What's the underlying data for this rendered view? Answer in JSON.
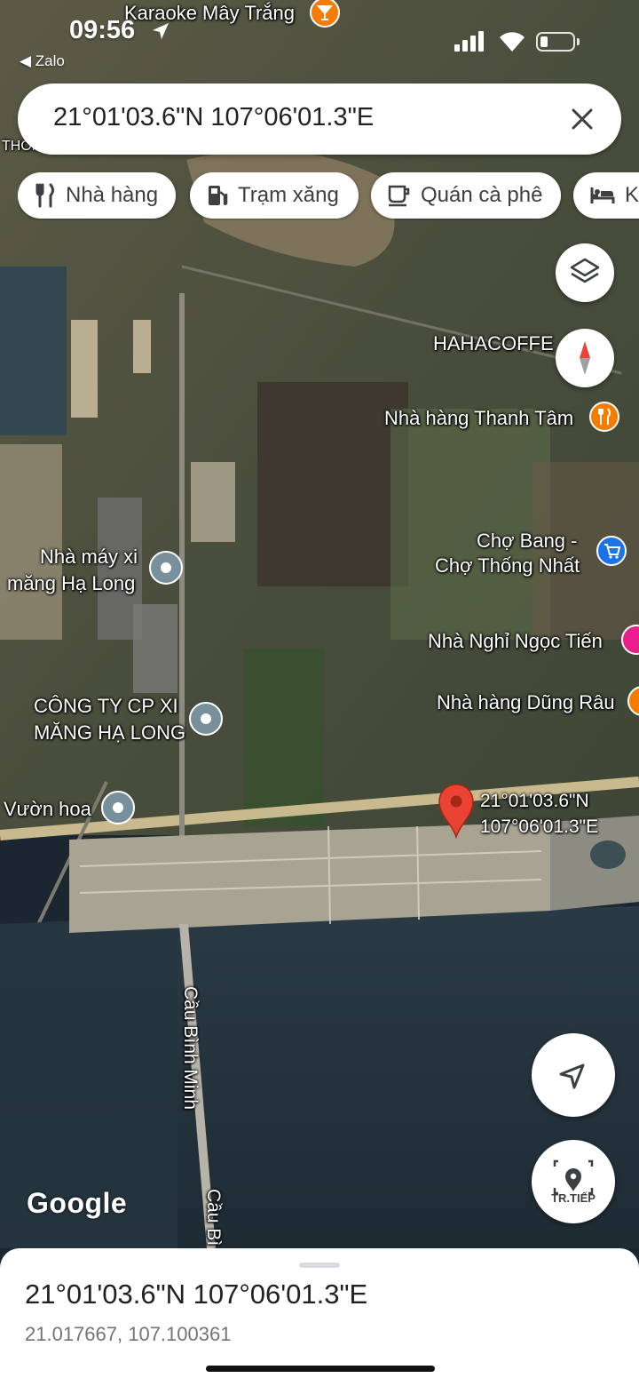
{
  "status_bar": {
    "time": "09:56",
    "back_app": "◀ Zalo"
  },
  "search": {
    "query": "21°01'03.6\"N 107°06'01.3\"E"
  },
  "chips": [
    {
      "label": "Nhà hàng",
      "icon": "restaurant-icon"
    },
    {
      "label": "Trạm xăng",
      "icon": "gas-station-icon"
    },
    {
      "label": "Quán cà phê",
      "icon": "coffee-icon"
    },
    {
      "label": "Khách sạn",
      "icon": "hotel-icon"
    }
  ],
  "map_labels": {
    "karaoke": "Karaoke Mây Trắng",
    "thong": "THỐNG",
    "hahacoffee": "HAHACOFFE",
    "thanh_tam": "Nhà hàng Thanh Tâm",
    "cho_bang_1": "Chợ Bang -",
    "cho_bang_2": "Chợ Thống Nhất",
    "ngoc_tien": "Nhà Nghỉ Ngọc Tiến",
    "dung_rau": "Nhà hàng Dũng Râu",
    "nha_may_1": "Nhà máy xi",
    "nha_may_2": "măng Hạ Long",
    "cong_ty_1": "CÔNG TY CP XI",
    "cong_ty_2": "MĂNG HẠ LONG",
    "vuon_hoa": "Vườn hoa",
    "pin_1": "21°01'03.6\"N",
    "pin_2": "107°06'01.3\"E",
    "bridge_1": "Cầu Bình Minh",
    "bridge_2": "Cầu Bì"
  },
  "fabs": {
    "navigate_label": "TR.TIẾP"
  },
  "attribution": "Google",
  "sheet": {
    "title": "21°01'03.6\"N 107°06'01.3\"E",
    "decimal": "21.017667, 107.100361"
  },
  "colors": {
    "pin": "#ea4335",
    "poi_orange": "#f57c00",
    "poi_blue": "#1a73e8",
    "poi_pink": "#e91e8c",
    "poi_grey": "#78909c"
  }
}
